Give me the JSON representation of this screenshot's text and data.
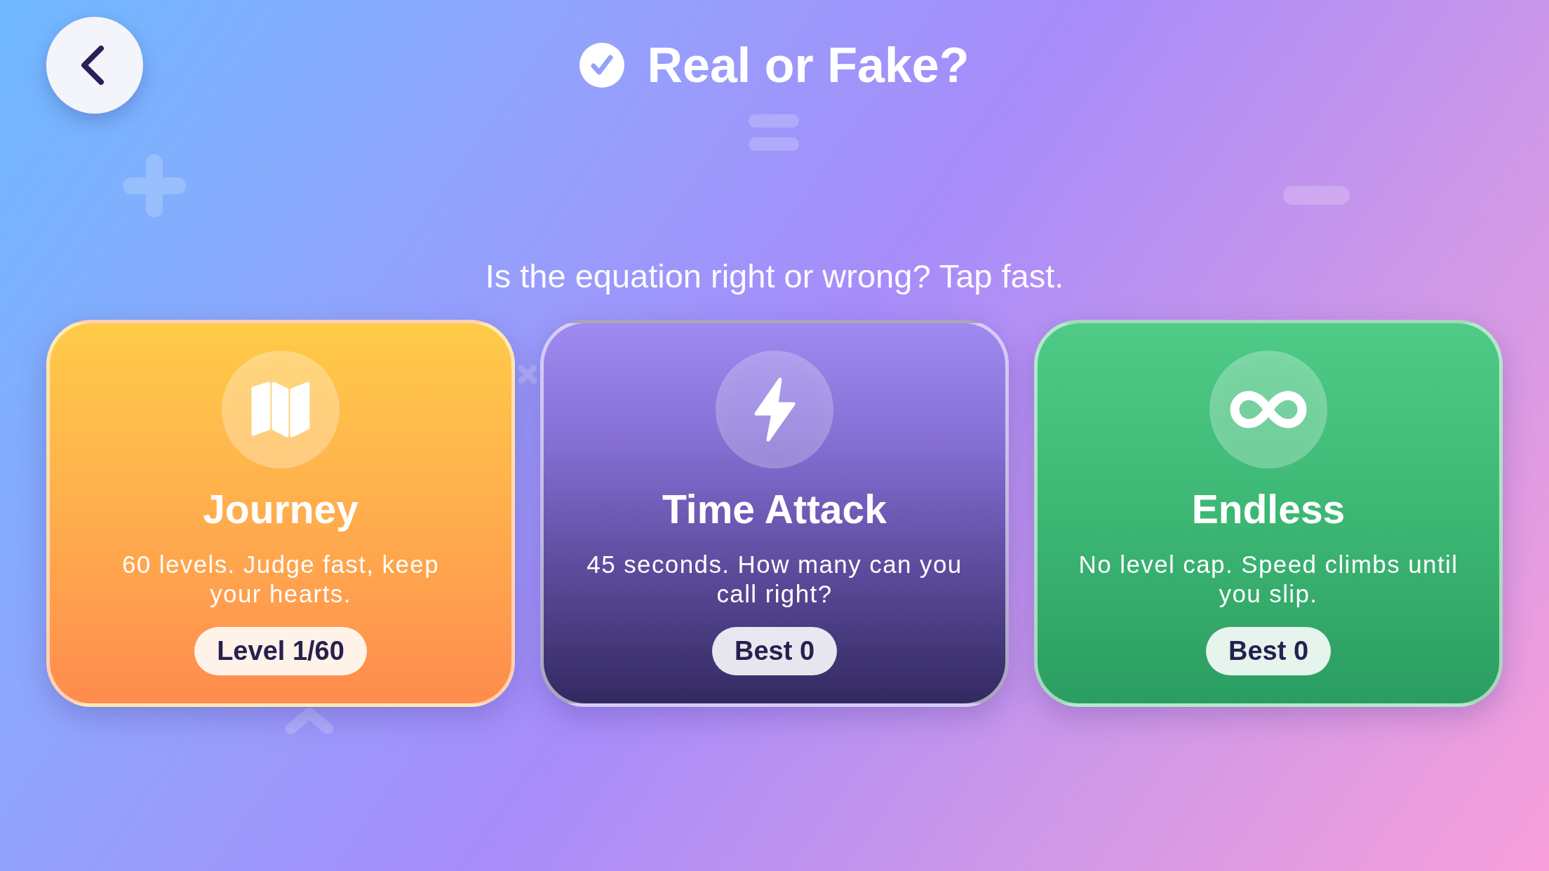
{
  "header": {
    "title": "Real or Fake?"
  },
  "subtitle": "Is the equation right or wrong? Tap fast.",
  "modes": [
    {
      "kind": "journey",
      "title": "Journey",
      "description": "60 levels. Judge fast, keep your hearts.",
      "badge": "Level 1/60"
    },
    {
      "kind": "time_attack",
      "title": "Time Attack",
      "description": "45 seconds. How many can you call right?",
      "badge": "Best 0"
    },
    {
      "kind": "endless",
      "title": "Endless",
      "description": "No level cap. Speed climbs until you slip.",
      "badge": "Best 0"
    }
  ]
}
